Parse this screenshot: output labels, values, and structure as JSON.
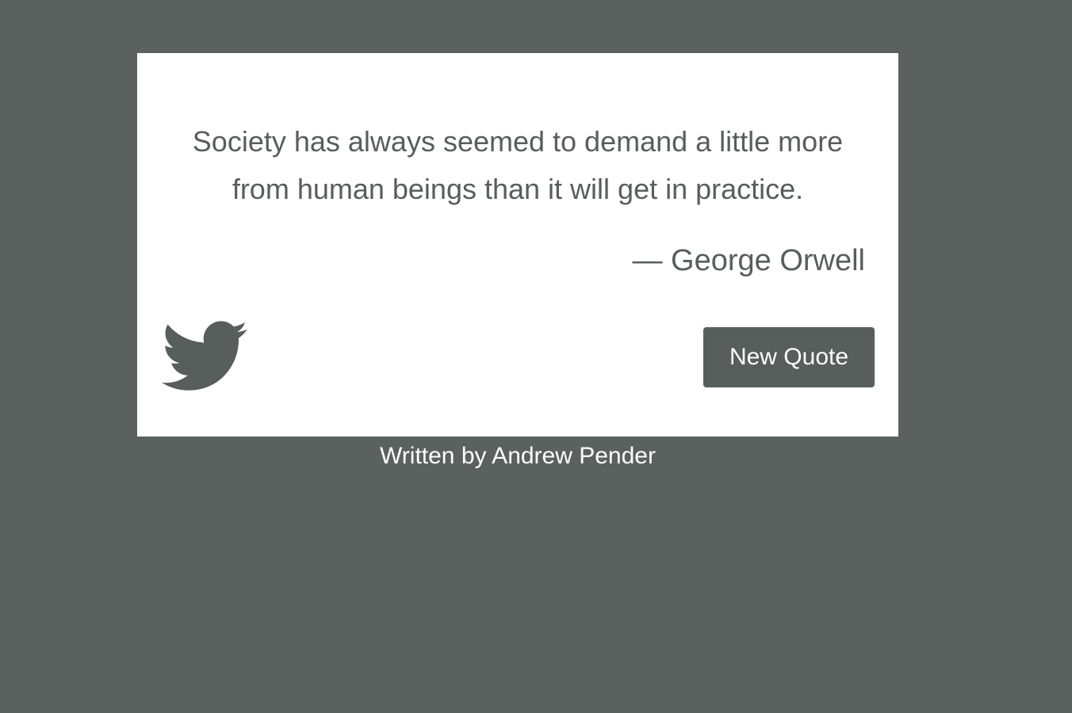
{
  "quote": {
    "text": "Society has always seemed to demand a little more from human beings than it will get in practice.",
    "author": "— George Orwell"
  },
  "actions": {
    "tweet_icon": "twitter-bird-icon",
    "new_quote_label": "New Quote"
  },
  "footer": {
    "credit": "Written by Andrew Pender"
  },
  "colors": {
    "background": "#5a615e",
    "card": "#ffffff",
    "text": "#575e5b",
    "button": "#575e5b",
    "button_text": "#ffffff"
  }
}
